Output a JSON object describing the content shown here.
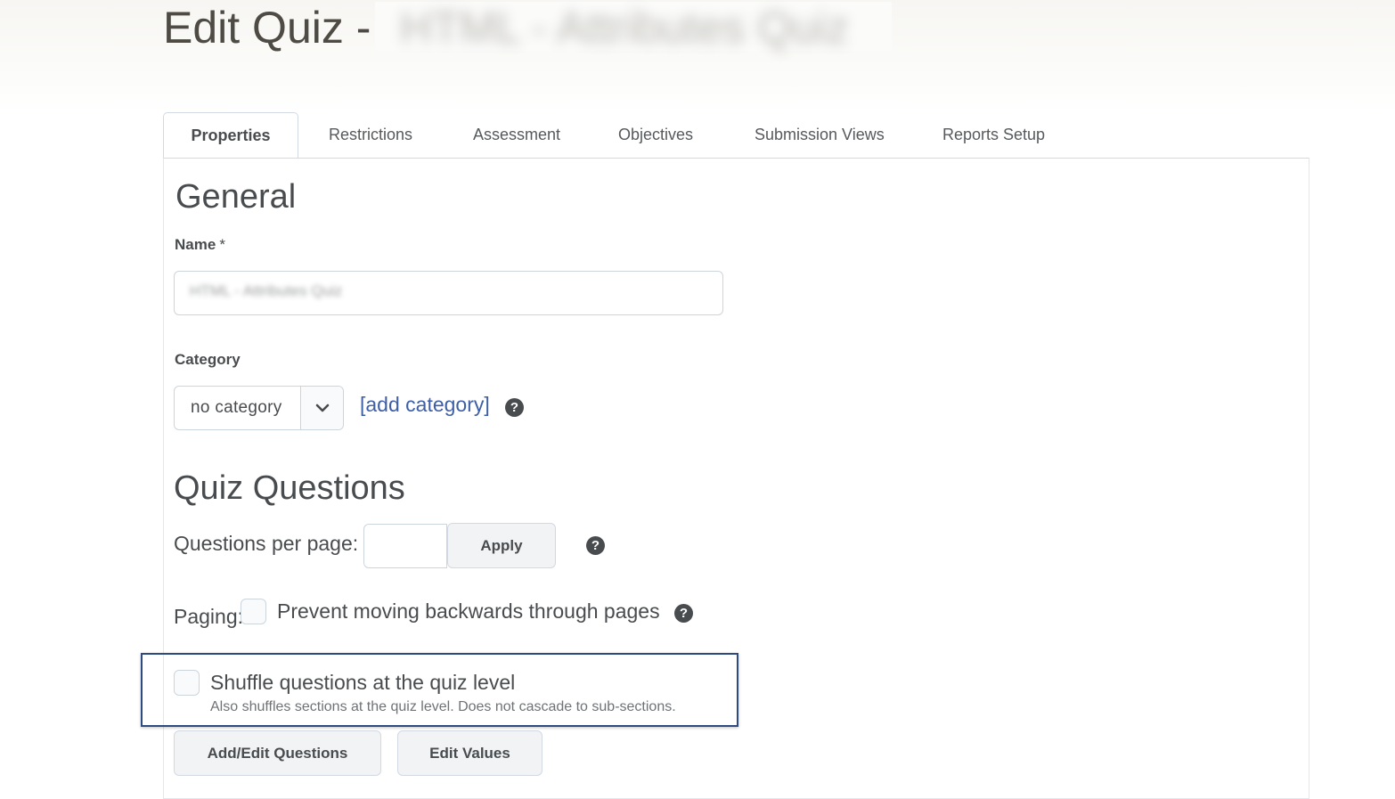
{
  "header": {
    "title_prefix": "Edit Quiz -",
    "title_obscured": "HTML - Attributes Quiz"
  },
  "tabs": [
    {
      "label": "Properties",
      "active": true
    },
    {
      "label": "Restrictions",
      "active": false
    },
    {
      "label": "Assessment",
      "active": false
    },
    {
      "label": "Objectives",
      "active": false
    },
    {
      "label": "Submission Views",
      "active": false
    },
    {
      "label": "Reports Setup",
      "active": false
    }
  ],
  "general": {
    "heading": "General",
    "name_label": "Name",
    "required_mark": "*",
    "name_value": "HTML - Attributes Quiz",
    "category_label": "Category",
    "category_value": "no category",
    "add_category_link": "[add category]"
  },
  "quiz_questions": {
    "heading": "Quiz Questions",
    "per_page_label": "Questions per page:",
    "per_page_value": "",
    "apply_button": "Apply",
    "paging_label": "Paging:",
    "prevent_backwards_label": "Prevent moving backwards through pages",
    "shuffle_label": "Shuffle questions at the quiz level",
    "shuffle_help": "Also shuffles sections at the quiz level. Does not cascade to sub-sections.",
    "add_edit_button": "Add/Edit Questions",
    "edit_values_button": "Edit Values"
  },
  "help_glyph": "?",
  "colors": {
    "link": "#3e5fa6",
    "highlight_border": "#2f4a7e",
    "text": "#494c4e"
  }
}
